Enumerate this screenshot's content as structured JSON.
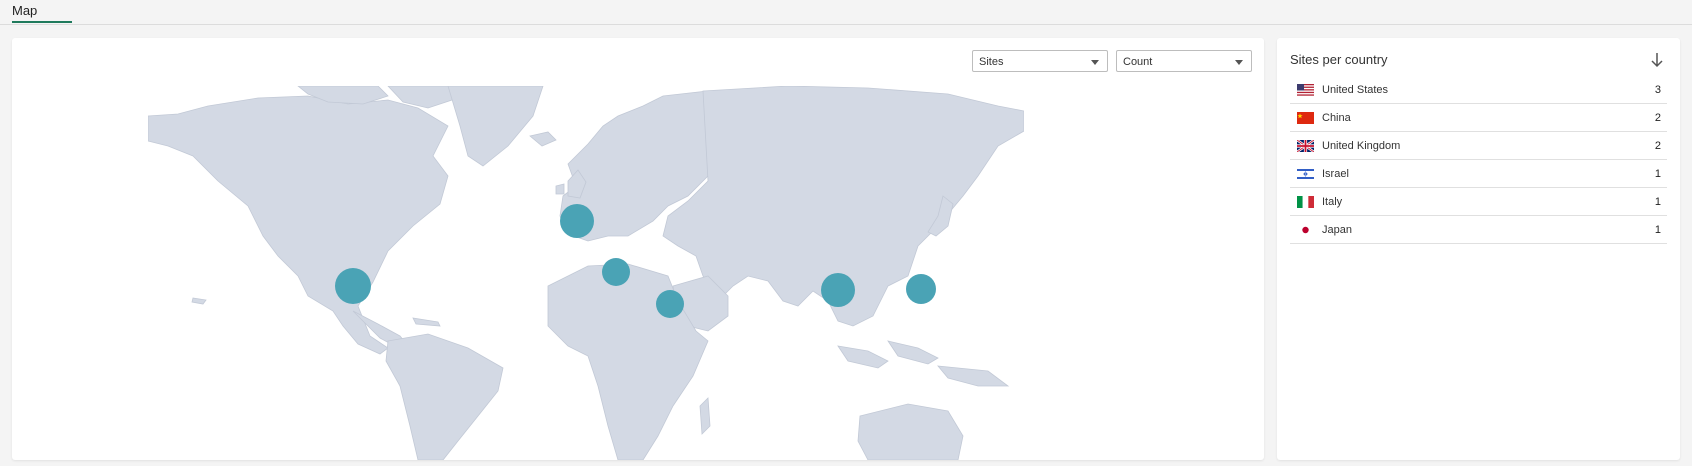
{
  "tabs": [
    {
      "label": "Map"
    }
  ],
  "filters": {
    "metric": "Sites",
    "measure": "Count"
  },
  "markers": [
    {
      "place": "United States"
    },
    {
      "place": "United Kingdom"
    },
    {
      "place": "Italy"
    },
    {
      "place": "Israel"
    },
    {
      "place": "China"
    },
    {
      "place": "Japan"
    }
  ],
  "side": {
    "title": "Sites per country",
    "rows": [
      {
        "country": "United States",
        "count": "3",
        "flag": "us-flag-icon"
      },
      {
        "country": "China",
        "count": "2",
        "flag": "china-flag-icon"
      },
      {
        "country": "United Kingdom",
        "count": "2",
        "flag": "uk-flag-icon"
      },
      {
        "country": "Israel",
        "count": "1",
        "flag": "israel-flag-icon"
      },
      {
        "country": "Italy",
        "count": "1",
        "flag": "italy-flag-icon"
      },
      {
        "country": "Japan",
        "count": "1",
        "flag": "japan-flag-icon"
      }
    ]
  },
  "colors": {
    "land": "#d3d9e4",
    "marker": "#4aa3b5",
    "accent": "#1f7a5c"
  }
}
